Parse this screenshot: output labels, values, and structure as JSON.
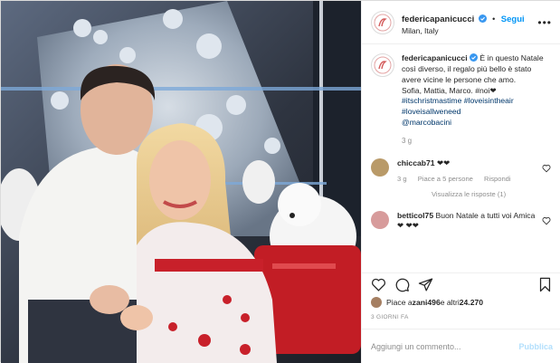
{
  "post": {
    "username": "federicapanicucci",
    "location": "Milan, Italy",
    "follow_label": "Segui",
    "more_label": "•••",
    "verified_icon": "verified-badge-icon",
    "photo_alt": "Couple in front of Christmas tree"
  },
  "caption": {
    "username": "federicapanicucci",
    "text_main": "È in questo Natale così diverso, il regalo più bello è stato avere vicine le persone che amo.",
    "text_names": "Sofia, Mattia, Marco. #noi❤",
    "hashtags": "#itschristmastime #loveisintheair #loveisallweneed",
    "mention": "@marcobacini",
    "time": "3 g"
  },
  "comments": [
    {
      "username": "chiccab71",
      "text": "❤❤",
      "likes_label": "Piace a 5 persone",
      "reply_label": "Rispondi",
      "time": "3 g",
      "avatar_color": "#b99a68"
    },
    {
      "username": "betticol75",
      "text": "Buon Natale a tutti voi Amica ❤ ❤❤",
      "avatar_color": "#d79b9b"
    }
  ],
  "view_replies": "Visualizza le risposte (1)",
  "likes": {
    "text_prefix": "Piace a ",
    "user": "zani496",
    "text_mid": " e altri ",
    "count": "24.270"
  },
  "date_label": "3 GIORNI FA",
  "add_comment": {
    "placeholder": "Aggiungi un commento...",
    "publish_label": "Pubblica"
  },
  "colors": {
    "accent": "#0095f6",
    "publish_disabled": "#b2dffc"
  }
}
